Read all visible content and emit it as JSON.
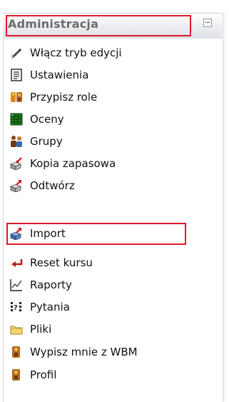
{
  "block": {
    "title": "Administracja",
    "collapse_icon": "minus-box-icon"
  },
  "items": [
    {
      "label": "Włącz tryb edycji",
      "icon": "edit-pencil-icon"
    },
    {
      "label": "Ustawienia",
      "icon": "settings-document-icon"
    },
    {
      "label": "Przypisz role",
      "icon": "assign-roles-icon"
    },
    {
      "label": "Oceny",
      "icon": "grades-grid-icon"
    },
    {
      "label": "Grupy",
      "icon": "groups-people-icon"
    },
    {
      "label": "Kopia zapasowa",
      "icon": "backup-box-icon"
    },
    {
      "label": "Odtwórz",
      "icon": "restore-box-icon"
    },
    {
      "label": "Import",
      "icon": "import-box-icon"
    },
    {
      "label": "Reset kursu",
      "icon": "reset-arrow-icon"
    },
    {
      "label": "Raporty",
      "icon": "reports-chart-icon"
    },
    {
      "label": "Pytania",
      "icon": "questions-icon"
    },
    {
      "label": "Pliki",
      "icon": "folder-icon"
    },
    {
      "label": "Wypisz mnie z WBM",
      "icon": "unenrol-person-icon"
    },
    {
      "label": "Profil",
      "icon": "profile-person-icon"
    }
  ],
  "colors": {
    "highlight": "#e0192c",
    "header_text": "#6b6b6b"
  }
}
